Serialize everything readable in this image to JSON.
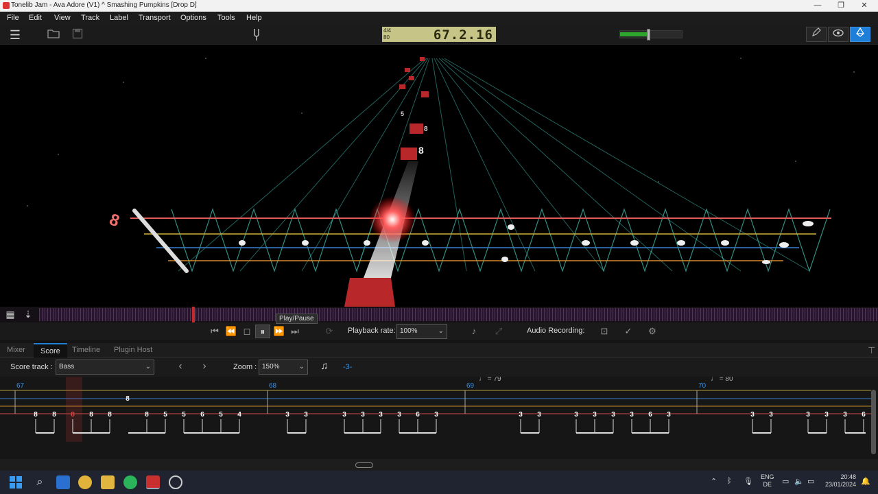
{
  "window": {
    "title": "Tonelib Jam - Ava Adore (V1) ^ Smashing Pumpkins [Drop D]",
    "minimize": "—",
    "maximize": "❐",
    "close": "✕"
  },
  "menu": [
    "File",
    "Edit",
    "View",
    "Track",
    "Label",
    "Transport",
    "Options",
    "Tools",
    "Help"
  ],
  "toolbar": {
    "time_signature": "4/4",
    "tempo": "80",
    "position": "67.2.16",
    "volume_level": 0.45,
    "icons": [
      "hamburger-icon",
      "open-folder-icon",
      "save-icon",
      "tuner-fork-icon",
      "pencil-icon",
      "eye-icon",
      "3d-view-icon"
    ]
  },
  "fretboard_3d": {
    "current_fret_label": "8",
    "upcoming_fret_labels": [
      "5",
      "8",
      "8"
    ],
    "colors": {
      "note": "#c03030",
      "glow": "#ff4040",
      "string_red": "#e35c5c",
      "string_yellow": "#d1b23a",
      "string_blue": "#3a7fd1",
      "string_orange": "#d98b2b",
      "frets": "#3fb3a8"
    }
  },
  "transport": {
    "tooltip": "Play/Pause",
    "playback_rate_label": "Playback rate:",
    "playback_rate_value": "100%",
    "audio_recording_label": "Audio Recording:"
  },
  "tabs": [
    "Mixer",
    "Score",
    "Timeline",
    "Plugin Host"
  ],
  "active_tab": "Score",
  "score_controls": {
    "score_track_label": "Score track :",
    "score_track_value": "Bass",
    "zoom_label": "Zoom :",
    "zoom_value": "150%",
    "transpose": "-3-"
  },
  "score": {
    "measures": [
      {
        "number": "67",
        "tempo": ""
      },
      {
        "number": "68",
        "tempo": ""
      },
      {
        "number": "69",
        "tempo": "= 79"
      },
      {
        "number": "70",
        "tempo": "= 80"
      }
    ],
    "upper_note": "8",
    "measure_67_notes": [
      "8",
      "8",
      "8",
      "8",
      "8",
      "8",
      "5",
      "5",
      "6",
      "5",
      "4"
    ],
    "measure_68_notes": [
      "3",
      "3",
      "3",
      "3",
      "3",
      "3",
      "6",
      "3"
    ],
    "measure_69_notes": [
      "3",
      "3",
      "3",
      "3",
      "3",
      "3",
      "6",
      "3"
    ],
    "measure_70_notes": [
      "3",
      "3",
      "3",
      "3",
      "3",
      "6"
    ]
  },
  "taskbar": {
    "language": "ENG",
    "layout": "DE",
    "time": "20:48",
    "date": "23/01/2024"
  }
}
